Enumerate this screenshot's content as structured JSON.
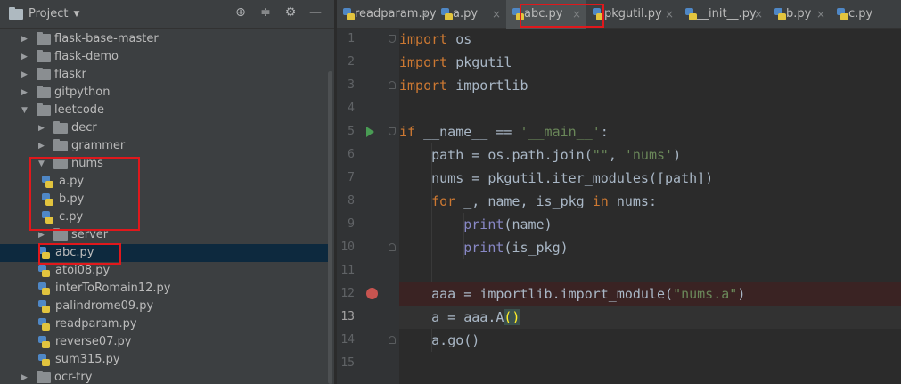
{
  "project_panel": {
    "title": "Project",
    "icons": [
      "project-folder-icon",
      "target-icon",
      "collapse-icon",
      "gear-icon",
      "hide-icon"
    ],
    "tree": [
      {
        "label": "flask-base-master",
        "type": "folder",
        "depth": 1,
        "expanded": false
      },
      {
        "label": "flask-demo",
        "type": "folder",
        "depth": 1,
        "expanded": false
      },
      {
        "label": "flaskr",
        "type": "folder",
        "depth": 1,
        "expanded": false
      },
      {
        "label": "gitpython",
        "type": "folder",
        "depth": 1,
        "expanded": false
      },
      {
        "label": "leetcode",
        "type": "folder",
        "depth": 1,
        "expanded": true
      },
      {
        "label": "decr",
        "type": "folder",
        "depth": 2,
        "expanded": false
      },
      {
        "label": "grammer",
        "type": "folder",
        "depth": 2,
        "expanded": false
      },
      {
        "label": "nums",
        "type": "folder",
        "depth": 2,
        "expanded": true
      },
      {
        "label": "a.py",
        "type": "py",
        "depth": 3
      },
      {
        "label": "b.py",
        "type": "py",
        "depth": 3
      },
      {
        "label": "c.py",
        "type": "py",
        "depth": 3
      },
      {
        "label": "server",
        "type": "folder",
        "depth": 2,
        "expanded": false
      },
      {
        "label": "abc.py",
        "type": "py",
        "depth": 2,
        "selected": true
      },
      {
        "label": "atoi08.py",
        "type": "py",
        "depth": 2
      },
      {
        "label": "interToRomain12.py",
        "type": "py",
        "depth": 2
      },
      {
        "label": "palindrome09.py",
        "type": "py",
        "depth": 2
      },
      {
        "label": "readparam.py",
        "type": "py",
        "depth": 2
      },
      {
        "label": "reverse07.py",
        "type": "py",
        "depth": 2
      },
      {
        "label": "sum315.py",
        "type": "py",
        "depth": 2
      },
      {
        "label": "ocr-try",
        "type": "folder",
        "depth": 1,
        "expanded": false
      }
    ]
  },
  "editor": {
    "tabs": [
      {
        "label": "readparam.py",
        "active": false
      },
      {
        "label": "a.py",
        "active": false
      },
      {
        "label": "abc.py",
        "active": true
      },
      {
        "label": "pkgutil.py",
        "active": false
      },
      {
        "label": "__init__.py",
        "active": false
      },
      {
        "label": "b.py",
        "active": false
      },
      {
        "label": "c.py",
        "active": false
      }
    ],
    "close_glyph": "×",
    "current_line": 13,
    "breakpoint_line": 12,
    "run_line": 5,
    "lines": [
      {
        "n": "1",
        "code": "import os"
      },
      {
        "n": "2",
        "code": "import pkgutil"
      },
      {
        "n": "3",
        "code": "import importlib"
      },
      {
        "n": "4",
        "code": ""
      },
      {
        "n": "5",
        "code": "if __name__ == '__main__':"
      },
      {
        "n": "6",
        "code": "    path = os.path.join(\"\", 'nums')"
      },
      {
        "n": "7",
        "code": "    nums = pkgutil.iter_modules([path])"
      },
      {
        "n": "8",
        "code": "    for _, name, is_pkg in nums:"
      },
      {
        "n": "9",
        "code": "        print(name)"
      },
      {
        "n": "10",
        "code": "        print(is_pkg)"
      },
      {
        "n": "11",
        "code": ""
      },
      {
        "n": "12",
        "code": "    aaa = importlib.import_module(\"nums.a\")"
      },
      {
        "n": "13",
        "code": "    a = aaa.A()"
      },
      {
        "n": "14",
        "code": "    a.go()"
      },
      {
        "n": "15",
        "code": ""
      }
    ]
  },
  "colors": {
    "panel_bg": "#3c3f41",
    "editor_bg": "#2b2b2b",
    "selection": "#0d293e",
    "keyword": "#cc7832",
    "string": "#6a8759",
    "builtin": "#8888c6",
    "highlight_box": "#e0181c"
  }
}
